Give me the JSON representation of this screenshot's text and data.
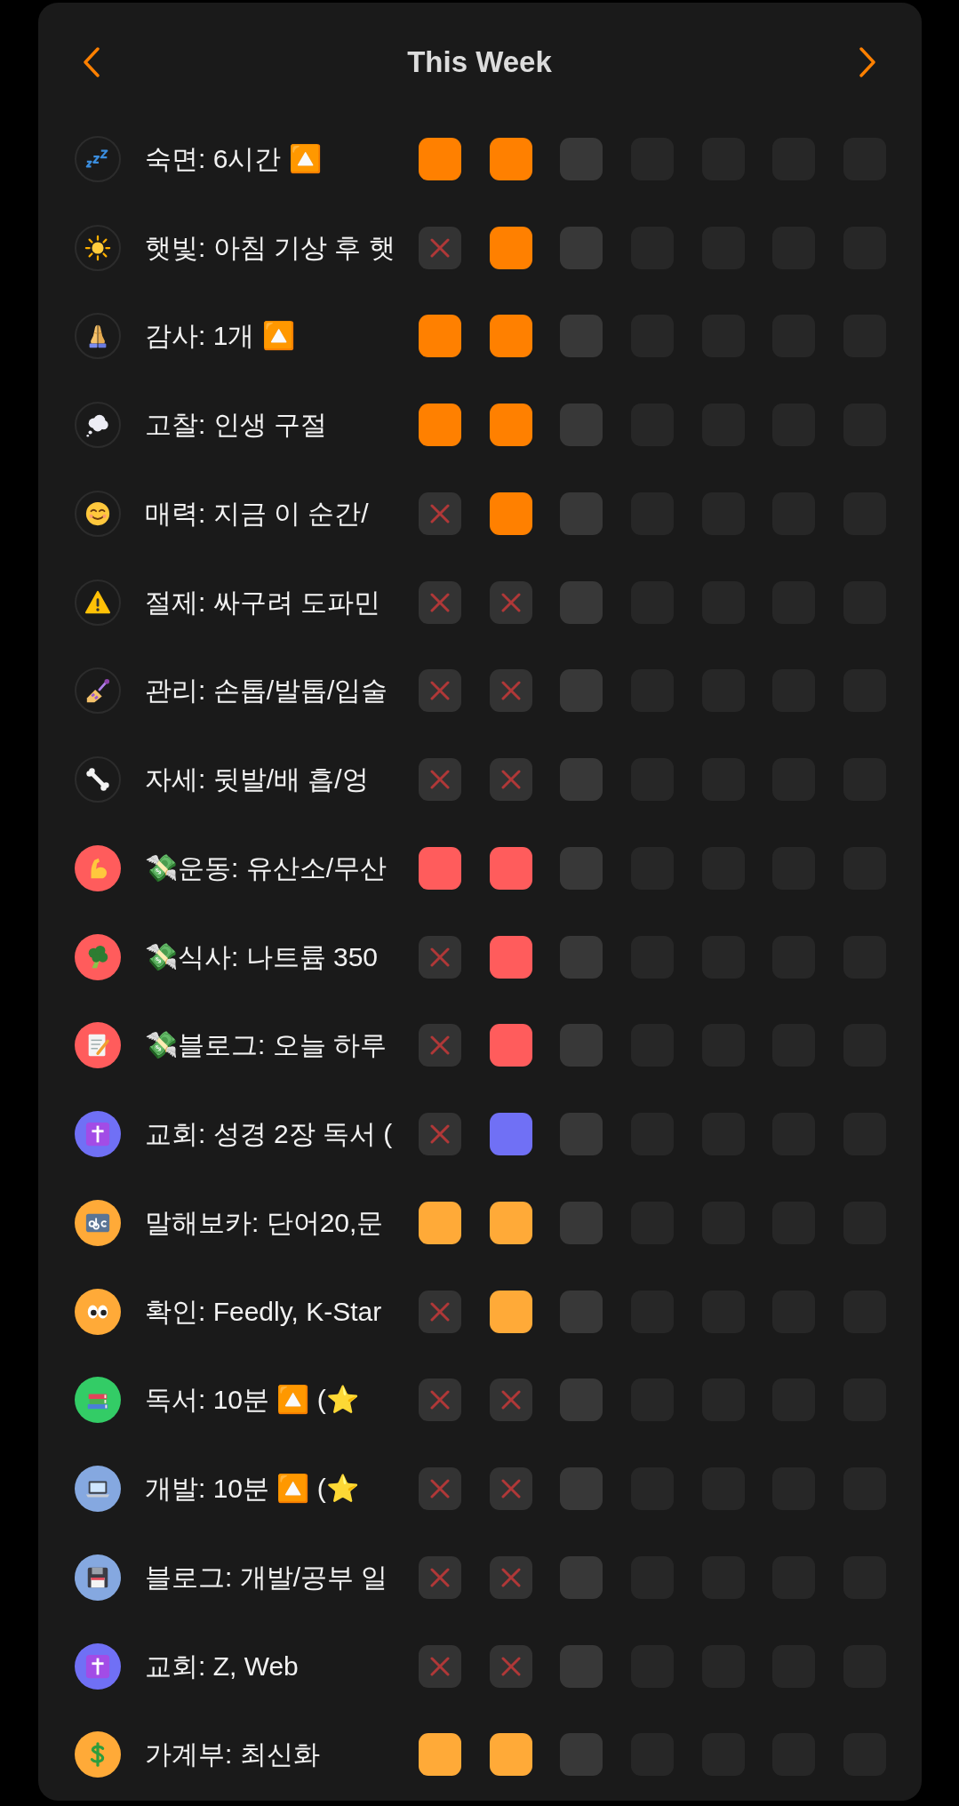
{
  "header": {
    "title": "This Week"
  },
  "habits": [
    {
      "name": "숙면: 6시간 🔼",
      "color": "#ff8000",
      "icon_filled": false,
      "days": [
        {
          "kind": "done"
        },
        {
          "kind": "done"
        },
        {
          "kind": "pending"
        },
        {
          "kind": "future"
        },
        {
          "kind": "future"
        },
        {
          "kind": "future"
        },
        {
          "kind": "future"
        }
      ]
    },
    {
      "name": "햇빛: 아침 기상 후 햇",
      "color": "#ff8000",
      "icon_filled": false,
      "days": [
        {
          "kind": "missed"
        },
        {
          "kind": "done"
        },
        {
          "kind": "pending"
        },
        {
          "kind": "future"
        },
        {
          "kind": "future"
        },
        {
          "kind": "future"
        },
        {
          "kind": "future"
        }
      ]
    },
    {
      "name": "감사: 1개 🔼",
      "color": "#ff8000",
      "icon_filled": false,
      "days": [
        {
          "kind": "done"
        },
        {
          "kind": "done"
        },
        {
          "kind": "pending"
        },
        {
          "kind": "future"
        },
        {
          "kind": "future"
        },
        {
          "kind": "future"
        },
        {
          "kind": "future"
        }
      ]
    },
    {
      "name": "고찰: 인생 구절",
      "color": "#ff8000",
      "icon_filled": false,
      "days": [
        {
          "kind": "done"
        },
        {
          "kind": "done"
        },
        {
          "kind": "pending"
        },
        {
          "kind": "future"
        },
        {
          "kind": "future"
        },
        {
          "kind": "future"
        },
        {
          "kind": "future"
        }
      ]
    },
    {
      "name": "매력: 지금 이 순간/",
      "color": "#ff8000",
      "icon_filled": false,
      "days": [
        {
          "kind": "missed"
        },
        {
          "kind": "done"
        },
        {
          "kind": "pending"
        },
        {
          "kind": "future"
        },
        {
          "kind": "future"
        },
        {
          "kind": "future"
        },
        {
          "kind": "future"
        }
      ]
    },
    {
      "name": "절제: 싸구려 도파민",
      "icon_filled": false,
      "days": [
        {
          "kind": "missed"
        },
        {
          "kind": "missed"
        },
        {
          "kind": "pending"
        },
        {
          "kind": "future"
        },
        {
          "kind": "future"
        },
        {
          "kind": "future"
        },
        {
          "kind": "future"
        }
      ]
    },
    {
      "name": "관리: 손톱/발톱/입술",
      "icon_filled": false,
      "days": [
        {
          "kind": "missed"
        },
        {
          "kind": "missed"
        },
        {
          "kind": "pending"
        },
        {
          "kind": "future"
        },
        {
          "kind": "future"
        },
        {
          "kind": "future"
        },
        {
          "kind": "future"
        }
      ]
    },
    {
      "name": "자세: 뒷발/배 흡/엉",
      "icon_filled": false,
      "days": [
        {
          "kind": "missed"
        },
        {
          "kind": "missed"
        },
        {
          "kind": "pending"
        },
        {
          "kind": "future"
        },
        {
          "kind": "future"
        },
        {
          "kind": "future"
        },
        {
          "kind": "future"
        }
      ]
    },
    {
      "name": "💸운동: 유산소/무산",
      "color": "#ff5c5c",
      "icon_filled": true,
      "days": [
        {
          "kind": "done"
        },
        {
          "kind": "done"
        },
        {
          "kind": "pending"
        },
        {
          "kind": "future"
        },
        {
          "kind": "future"
        },
        {
          "kind": "future"
        },
        {
          "kind": "future"
        }
      ]
    },
    {
      "name": "💸식사: 나트륨 350",
      "color": "#ff5c5c",
      "icon_filled": true,
      "days": [
        {
          "kind": "missed"
        },
        {
          "kind": "done"
        },
        {
          "kind": "pending"
        },
        {
          "kind": "future"
        },
        {
          "kind": "future"
        },
        {
          "kind": "future"
        },
        {
          "kind": "future"
        }
      ]
    },
    {
      "name": "💸블로그: 오늘 하루",
      "color": "#ff5c5c",
      "icon_filled": true,
      "days": [
        {
          "kind": "missed"
        },
        {
          "kind": "done"
        },
        {
          "kind": "pending"
        },
        {
          "kind": "future"
        },
        {
          "kind": "future"
        },
        {
          "kind": "future"
        },
        {
          "kind": "future"
        }
      ]
    },
    {
      "name": "교회: 성경 2장 독서 (",
      "color": "#7070f5",
      "icon_filled": true,
      "days": [
        {
          "kind": "missed"
        },
        {
          "kind": "done"
        },
        {
          "kind": "pending"
        },
        {
          "kind": "future"
        },
        {
          "kind": "future"
        },
        {
          "kind": "future"
        },
        {
          "kind": "future"
        }
      ]
    },
    {
      "name": "말해보카: 단어20,문",
      "color": "#ffaa38",
      "icon_filled": true,
      "days": [
        {
          "kind": "done"
        },
        {
          "kind": "done"
        },
        {
          "kind": "pending"
        },
        {
          "kind": "future"
        },
        {
          "kind": "future"
        },
        {
          "kind": "future"
        },
        {
          "kind": "future"
        }
      ]
    },
    {
      "name": "확인: Feedly, K-Star",
      "color": "#ffaa38",
      "icon_filled": true,
      "days": [
        {
          "kind": "missed"
        },
        {
          "kind": "done"
        },
        {
          "kind": "pending"
        },
        {
          "kind": "future"
        },
        {
          "kind": "future"
        },
        {
          "kind": "future"
        },
        {
          "kind": "future"
        }
      ]
    },
    {
      "name": "독서: 10분 🔼 (⭐",
      "color": "#33cc66",
      "icon_filled": true,
      "days": [
        {
          "kind": "missed"
        },
        {
          "kind": "missed"
        },
        {
          "kind": "pending"
        },
        {
          "kind": "future"
        },
        {
          "kind": "future"
        },
        {
          "kind": "future"
        },
        {
          "kind": "future"
        }
      ]
    },
    {
      "name": "개발: 10분 🔼 (⭐",
      "color": "#85a8e0",
      "icon_filled": true,
      "days": [
        {
          "kind": "missed"
        },
        {
          "kind": "missed"
        },
        {
          "kind": "pending"
        },
        {
          "kind": "future"
        },
        {
          "kind": "future"
        },
        {
          "kind": "future"
        },
        {
          "kind": "future"
        }
      ]
    },
    {
      "name": "블로그: 개발/공부 일",
      "color": "#85a8e0",
      "icon_filled": true,
      "days": [
        {
          "kind": "missed"
        },
        {
          "kind": "missed"
        },
        {
          "kind": "pending"
        },
        {
          "kind": "future"
        },
        {
          "kind": "future"
        },
        {
          "kind": "future"
        },
        {
          "kind": "future"
        }
      ]
    },
    {
      "name": "교회: Z, Web",
      "color": "#7070f5",
      "icon_filled": true,
      "days": [
        {
          "kind": "missed"
        },
        {
          "kind": "missed"
        },
        {
          "kind": "pending"
        },
        {
          "kind": "future"
        },
        {
          "kind": "future"
        },
        {
          "kind": "future"
        },
        {
          "kind": "future"
        }
      ]
    },
    {
      "name": "가계부: 최신화",
      "color": "#ffaa38",
      "icon_filled": true,
      "days": [
        {
          "kind": "done"
        },
        {
          "kind": "done"
        },
        {
          "kind": "pending"
        },
        {
          "kind": "future"
        },
        {
          "kind": "future"
        },
        {
          "kind": "future"
        },
        {
          "kind": "future"
        }
      ]
    }
  ]
}
